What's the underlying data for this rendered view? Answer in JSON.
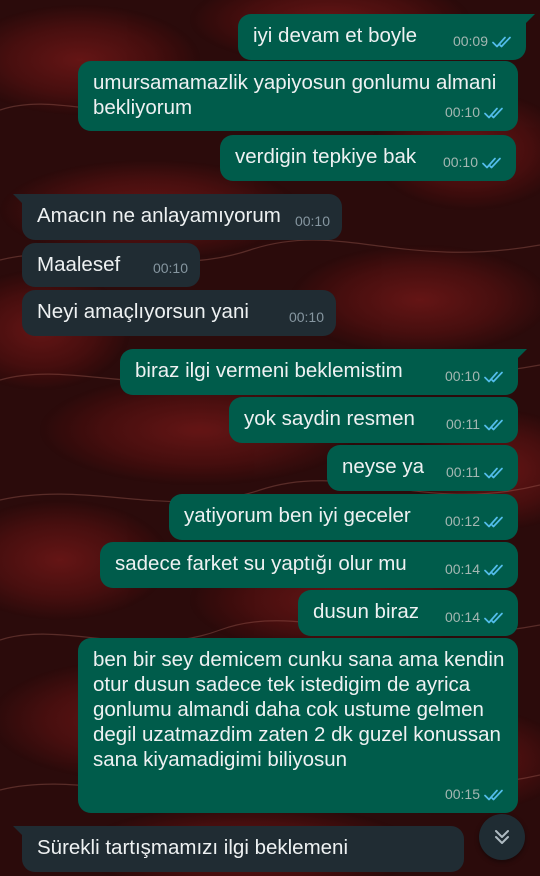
{
  "colors": {
    "outgoing_bubble": "#005c4b",
    "incoming_bubble": "#202c33",
    "read_ticks": "#53bdeb",
    "wallpaper_base": "#2a0d0d"
  },
  "messages": [
    {
      "dir": "out",
      "text": "iyi devam et boyle",
      "time": "00:09",
      "status": "read-ticks-icon"
    },
    {
      "dir": "out",
      "text": "umursamamazlik yapiyosun gonlumu almani bekliyorum",
      "time": "00:10",
      "status": "read-ticks-icon"
    },
    {
      "dir": "out",
      "text": "verdigin tepkiye bak",
      "time": "00:10",
      "status": "read-ticks-icon"
    },
    {
      "dir": "in",
      "text": "Amacın ne anlayamıyorum",
      "time": "00:10"
    },
    {
      "dir": "in",
      "text": "Maalesef",
      "time": "00:10"
    },
    {
      "dir": "in",
      "text": "Neyi amaçlıyorsun yani",
      "time": "00:10"
    },
    {
      "dir": "out",
      "text": "biraz ilgi vermeni beklemistim",
      "time": "00:10",
      "status": "read-ticks-icon"
    },
    {
      "dir": "out",
      "text": "yok saydin resmen",
      "time": "00:11",
      "status": "read-ticks-icon"
    },
    {
      "dir": "out",
      "text": "neyse ya",
      "time": "00:11",
      "status": "read-ticks-icon"
    },
    {
      "dir": "out",
      "text": "yatiyorum ben iyi geceler",
      "time": "00:12",
      "status": "read-ticks-icon"
    },
    {
      "dir": "out",
      "text": "sadece farket su yaptığı olur mu",
      "time": "00:14",
      "status": "read-ticks-icon"
    },
    {
      "dir": "out",
      "text": "dusun biraz",
      "time": "00:14",
      "status": "read-ticks-icon"
    },
    {
      "dir": "out",
      "text": "ben bir sey demicem cunku sana ama kendin otur dusun sadece tek istedigim de ayrica gonlumu almandi daha cok ustume gelmen degil uzatmazdim zaten 2 dk guzel konussan sana kiyamadigimi biliyosun",
      "time": "00:15",
      "status": "read-ticks-icon"
    },
    {
      "dir": "in",
      "text": "Sürekli tartışmamızı ilgi beklemeni",
      "time": ""
    }
  ],
  "scroll_button": {
    "icon": "double-chevron-down-icon"
  }
}
